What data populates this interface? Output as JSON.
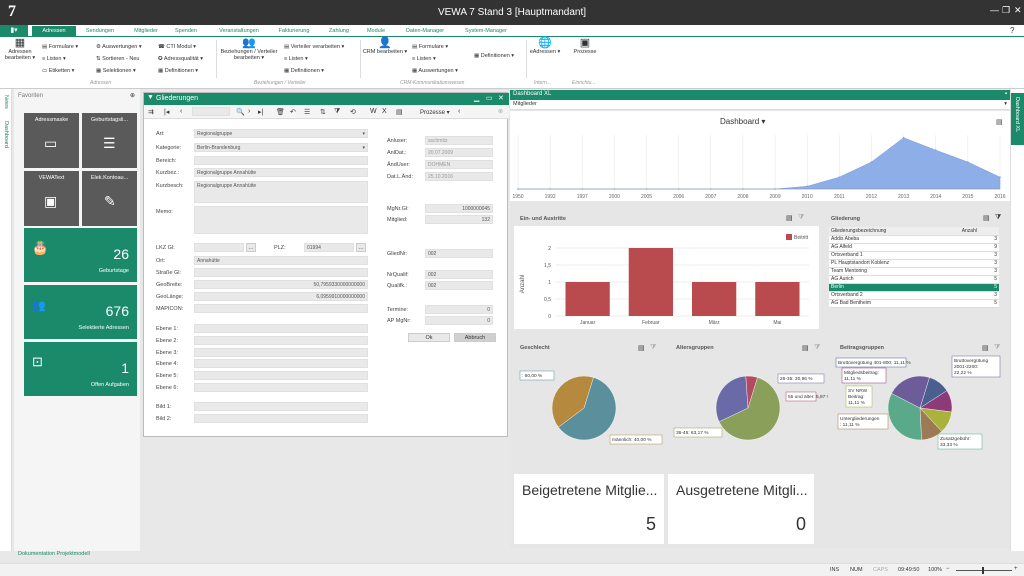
{
  "titlebar": {
    "title": "VEWA 7 Stand 3 [Hauptmandant]",
    "logo": "7"
  },
  "tabs": [
    "Adressen",
    "Sendungen",
    "Mitglieder",
    "Spenden",
    "Veranstaltungen",
    "Fakturierung",
    "Zahlung",
    "Module",
    "Daten-Manager",
    "System-Manager"
  ],
  "ribbon": {
    "adressen_bearbeiten": "Adressen bearbeiten ▾",
    "col1": [
      "Formulare ▾",
      "Listen ▾",
      "Etiketten ▾"
    ],
    "col2": [
      "Auswertungen ▾",
      "Sortieren - Neu",
      "Selektionen ▾"
    ],
    "col3": [
      "CTI Modul ▾",
      "Adressqualität ▾",
      "Definitionen ▾"
    ],
    "beziehungen": "Beziehungen / Verteiler bearbeiten ▾",
    "col4": [
      "Verteiler verarbeiten ▾",
      "Listen ▾",
      "Definitionen ▾"
    ],
    "crm": "CRM bearbeiten ▾",
    "col5": [
      "Formulare ▾",
      "Listen ▾",
      "Auswertungen ▾"
    ],
    "definitionen": "Definitionen ▾",
    "eadressen": "eAdressen ▾",
    "prozesse": "Prozesse",
    "groups": [
      "Adressen",
      "Beziehungen / Verteiler",
      "CRM-Kommunikationswesen",
      "Intern...",
      "Einrichtu..."
    ]
  },
  "left": {
    "news": "News",
    "dashboard": "Dashboard",
    "favoriten": "Favoriten",
    "footer_link": "Dokumentation Projektmodell"
  },
  "tiles": [
    {
      "label": "Adressmaske"
    },
    {
      "label": "Geburtstagsli..."
    },
    {
      "label": "VEWAText"
    },
    {
      "label": "Elek.Kontoau..."
    }
  ],
  "counters": [
    {
      "value": "26",
      "caption": "Geburtstage"
    },
    {
      "value": "676",
      "caption": "Selektierte Adressen"
    },
    {
      "value": "1",
      "caption": "Offen Aufgaben"
    }
  ],
  "gliederungen": {
    "title": "Gliederungen",
    "prozesse": "Prozesse",
    "labels": {
      "art": "Art:",
      "kategorie": "Kategorie:",
      "bereich": "Bereich:",
      "kurzbez": "Kurzbez.:",
      "kurzbesch": "Kurzbesch:",
      "memo": "Memo:",
      "lkz": "LKZ Gl:",
      "plz": "PLZ:",
      "ort": "Ort:",
      "strasse": "Straße Gl:",
      "geobreite": "GeoBreite:",
      "geolaenge": "GeoLänge:",
      "mapicon": "MAPICON:",
      "ebene1": "Ebene 1:",
      "ebene2": "Ebene 2:",
      "ebene3": "Ebene 3:",
      "ebene4": "Ebene 4:",
      "ebene5": "Ebene 5:",
      "ebene6": "Ebene 6:",
      "bild1": "Bild 1:",
      "bild2": "Bild 2:",
      "anluser": "Anluser:",
      "anldat": "AnlDat.:",
      "aenduser": "ÄndUser:",
      "datlaend": "Dat.L.Änd:",
      "mgnrgl": "MgNr.Gl:",
      "mitglied": "Mitglied:",
      "gliednr": "GliedNr:",
      "nrqualif": "NrQualif:",
      "qualifk": "Qualifk.:",
      "termine": "Termine:",
      "apmgnr": "AP MgNr:"
    },
    "values": {
      "art": "Regionalgruppe",
      "kategorie": "Berlin-Brandenburg",
      "bereich": "",
      "kurzbez": "Regionalgruppe Annahütte",
      "kurzbesch": "Regionalgruppe Annahütte",
      "memo": "",
      "lkz": "",
      "plz": "01994",
      "ort": "Annahütte",
      "strasse": "",
      "geobreite": "50,7959330000000000",
      "geolaenge": "6,0959910000000000",
      "mapicon": "",
      "anluser": "sschmitz",
      "anldat": "20.07.2009",
      "aenduser": "DOHMEN",
      "datlaend": "25.10.2016",
      "mgnrgl": "1000000045",
      "mitglied": "132",
      "gliednr": "002",
      "nrqualif": "002",
      "qualifk": "002",
      "termine": "0",
      "apmgnr": "0"
    },
    "ok": "Ok",
    "abbruch": "Abbruch"
  },
  "dashboard": {
    "title": "Dashboard XL",
    "select": "Mitglieder",
    "heading": "Dashboard",
    "years": [
      "1950",
      "1992",
      "1997",
      "2000",
      "2005",
      "2006",
      "2007",
      "2008",
      "2009",
      "2010",
      "2011",
      "2012",
      "2013",
      "2014",
      "2015",
      "2016"
    ],
    "side_label": "Dashboard XL",
    "kpi": [
      {
        "title": "Beigetretene Mitglie...",
        "value": "5"
      },
      {
        "title": "Ausgetretene Mitgli...",
        "value": "0"
      }
    ],
    "tbl_header": [
      "Gliederungsbezeichnung",
      "Anzahl"
    ],
    "tbl_rows": [
      [
        "Addis Abeba",
        "3"
      ],
      [
        "AG Alfeld",
        "9"
      ],
      [
        "Ortsverband 1",
        "3"
      ],
      [
        "PL Hauptstandort Koblenz",
        "3"
      ],
      [
        "Team Mentoring",
        "3"
      ],
      [
        "AG Aurich",
        "5"
      ],
      [
        "Berlin",
        "5"
      ],
      [
        "Ortsverband 2",
        "3"
      ],
      [
        "AG Bad Bentheim",
        "5"
      ]
    ],
    "titles": {
      "einaus": "Ein- und Austritte",
      "gliederung": "Gliederung",
      "geschlecht": "Geschlecht",
      "alter": "Altersgruppen",
      "beitrag": "Beitragsgruppen"
    }
  },
  "chart_data": [
    {
      "type": "area",
      "x": [
        "1950",
        "1992",
        "1997",
        "2000",
        "2005",
        "2006",
        "2007",
        "2008",
        "2009",
        "2010",
        "2011",
        "2012",
        "2013",
        "2014",
        "2015",
        "2016"
      ],
      "values": [
        0,
        0,
        0,
        0,
        0,
        0,
        0,
        0,
        0,
        0.05,
        0.22,
        0.5,
        0.95,
        0.72,
        0.5,
        0.22
      ],
      "title": "Dashboard"
    },
    {
      "type": "bar",
      "categories": [
        "Januar",
        "Februar",
        "März",
        "Mai"
      ],
      "series": [
        {
          "name": "Beitritt",
          "values": [
            1,
            2,
            1,
            1
          ]
        }
      ],
      "ylabel": "Anzahl",
      "ylim": [
        0,
        2
      ]
    },
    {
      "type": "pie",
      "title": "Geschlecht",
      "labels": [
        ": 60,00 %",
        "männlich: 40,00 %"
      ],
      "values": [
        60,
        40
      ]
    },
    {
      "type": "pie",
      "title": "Altersgruppen",
      "labels": [
        "36-45: 63,17 %",
        "26-35: 30,96 %",
        "55 und älter: 5,87 %"
      ],
      "values": [
        63.17,
        30.96,
        5.87
      ]
    },
    {
      "type": "pie",
      "title": "Beitragsgruppen",
      "labels": [
        "Bruttovergütung 401-800: 11,11 %",
        "Mitgliedsbeitrag: 11,11 %",
        "SV NRW Beitrag: 11,11 %",
        "Untergliederungen: 11,11 %",
        "Zusatzgebühr: 33,33 %",
        "Bruttovergütung 2001-2200: 22,22 %"
      ],
      "values": [
        11.11,
        11.11,
        11.11,
        11.11,
        33.33,
        22.22
      ]
    }
  ],
  "status": {
    "ins": "INS",
    "num": "NUM",
    "caps": "CAPS",
    "time": "09:49:50",
    "zoom": "100%"
  },
  "colors": {
    "accent": "#1b8a6b",
    "bar": "#b94a4d",
    "area": "#8eaee8"
  }
}
